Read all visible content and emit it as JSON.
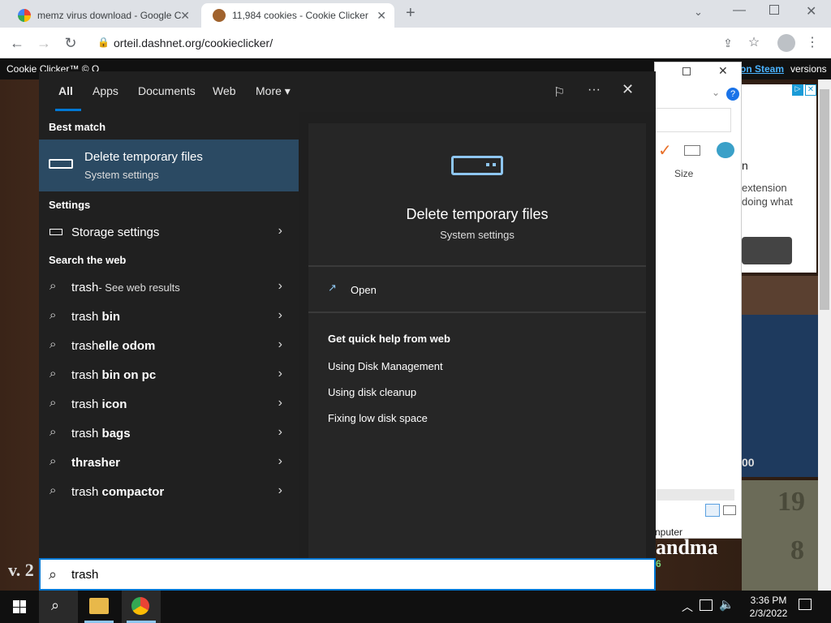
{
  "browser": {
    "tabs": [
      {
        "title": "memz virus download - Google C",
        "active": false
      },
      {
        "title": "11,984 cookies - Cookie Clicker",
        "active": true
      }
    ],
    "new_tab": "+",
    "url": "orteil.dashnet.org/cookieclicker/"
  },
  "page": {
    "title": "Cookie Clicker™ © O",
    "right_links": "on Steam",
    "versions": "versions",
    "version_label": "v. 2",
    "grandma_label": "andma",
    "counts": [
      "19",
      "8"
    ],
    "score_suffix": "00",
    "six": "6"
  },
  "explorer": {
    "size_col": "Size",
    "computer_label": "nputer"
  },
  "ad": {
    "lines": [
      "n",
      "extension",
      "doing what"
    ]
  },
  "search": {
    "tabs": [
      "All",
      "Apps",
      "Documents",
      "Web",
      "More"
    ],
    "best_match_label": "Best match",
    "best_match": {
      "title": "Delete temporary files",
      "subtitle": "System settings"
    },
    "settings_label": "Settings",
    "settings_items": [
      "Storage settings"
    ],
    "web_label": "Search the web",
    "web_items": [
      {
        "prefix": "trash",
        "bold": "",
        "suffix": " - See web results"
      },
      {
        "prefix": "trash",
        "bold": " bin",
        "suffix": ""
      },
      {
        "prefix": "trash",
        "bold": "elle odom",
        "suffix": ""
      },
      {
        "prefix": "trash",
        "bold": " bin on pc",
        "suffix": ""
      },
      {
        "prefix": "trash",
        "bold": " icon",
        "suffix": ""
      },
      {
        "prefix": "trash",
        "bold": " bags",
        "suffix": ""
      },
      {
        "prefix": "",
        "bold": "thrasher",
        "suffix": ""
      },
      {
        "prefix": "trash",
        "bold": " compactor",
        "suffix": ""
      }
    ],
    "preview": {
      "title": "Delete temporary files",
      "subtitle": "System settings",
      "open": "Open",
      "help_title": "Get quick help from web",
      "help_links": [
        "Using Disk Management",
        "Using disk cleanup",
        "Fixing low disk space"
      ]
    },
    "query": "trash"
  },
  "taskbar": {
    "time": "3:36 PM",
    "date": "2/3/2022"
  },
  "colors": {
    "accent": "#0078d4",
    "selected": "#2b4a63"
  }
}
